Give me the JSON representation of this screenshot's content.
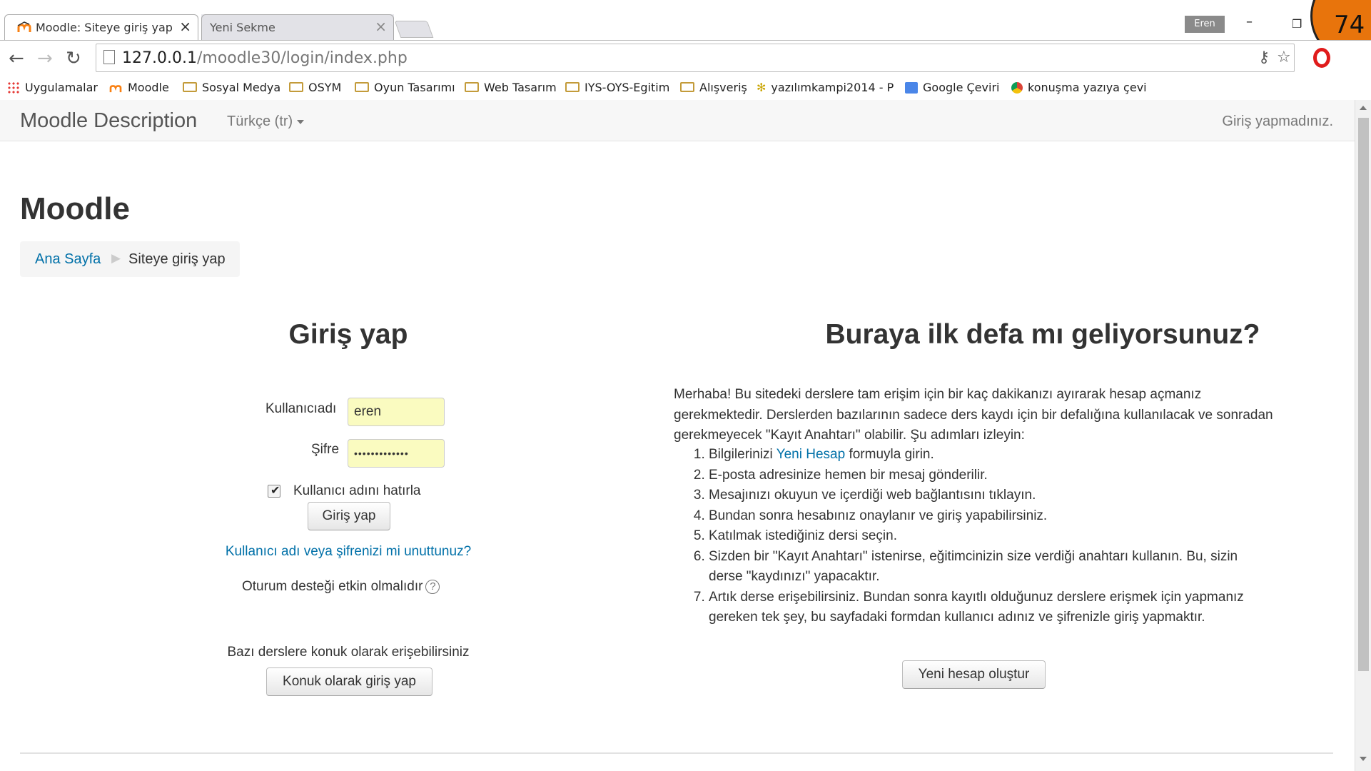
{
  "browser": {
    "active_tab": {
      "title": "Moodle: Siteye giriş yap",
      "close": "×"
    },
    "inactive_tab": {
      "title": "Yeni Sekme",
      "close": "×"
    },
    "profile_name": "Eren",
    "window_min": "–",
    "window_restore": "❐",
    "overlay_badge": "74",
    "url_host": "127.0.0.1",
    "url_path": "/moodle30/login/index.php",
    "bookmarks": [
      {
        "label": "Uygulamalar",
        "icon": "apps-grid-icon"
      },
      {
        "label": "Moodle",
        "icon": "moodle-icon"
      },
      {
        "label": "Sosyal Medya",
        "icon": "folder-icon"
      },
      {
        "label": "OSYM",
        "icon": "folder-icon"
      },
      {
        "label": "Oyun Tasarımı",
        "icon": "folder-icon"
      },
      {
        "label": "Web Tasarım",
        "icon": "folder-icon"
      },
      {
        "label": "IYS-OYS-Egitim",
        "icon": "folder-icon"
      },
      {
        "label": "Alışveriş",
        "icon": "folder-icon"
      },
      {
        "label": "yazılımkampi2014 - P",
        "icon": "cheetah-icon"
      },
      {
        "label": "Google Çeviri",
        "icon": "translate-icon"
      },
      {
        "label": "konuşma yazıya çevir",
        "icon": "chrome-icon"
      }
    ]
  },
  "navbar": {
    "brand": "Moodle Description",
    "language": "Türkçe (tr)",
    "login_state": "Giriş yapmadınız."
  },
  "page": {
    "heading": "Moodle",
    "breadcrumb": {
      "home": "Ana Sayfa",
      "separator": "▶",
      "current": "Siteye giriş yap"
    }
  },
  "login": {
    "title": "Giriş yap",
    "username_label": "Kullanıcıadı",
    "username_value": "eren",
    "password_label": "Şifre",
    "password_value": "•••••••••••••",
    "remember_label": "Kullanıcı adını hatırla",
    "remember_checked": true,
    "submit": "Giriş yap",
    "forgot": "Kullanıcı adı veya şifrenizi mi unuttunuz?",
    "cookies_notice": "Oturum desteği etkin olmalıdır",
    "help_glyph": "?",
    "guest_text": "Bazı derslere konuk olarak erişebilirsiniz",
    "guest_button": "Konuk olarak giriş yap"
  },
  "signup": {
    "title": "Buraya ilk defa mı geliyorsunuz?",
    "intro": "Merhaba! Bu sitedeki derslere tam erişim için bir kaç dakikanızı ayırarak hesap açmanız gerekmektedir. Derslerden bazılarının sadece ders kaydı için bir defalığına kullanılacak ve sonradan gerekmeyecek \"Kayıt Anahtarı\" olabilir. Şu adımları izleyin:",
    "step1_pre": "Bilgilerinizi ",
    "step1_link": "Yeni Hesap",
    "step1_post": " formuyla girin.",
    "steps": [
      "E-posta adresinize hemen bir mesaj gönderilir.",
      "Mesajınızı okuyun ve içerdiği web bağlantısını tıklayın.",
      "Bundan sonra hesabınız onaylanır ve giriş yapabilirsiniz.",
      "Katılmak istediğiniz dersi seçin.",
      "Sizden bir \"Kayıt Anahtarı\" istenirse, eğitimcinizin size verdiği anahtarı kullanın. Bu, sizin derse \"kaydınızı\" yapacaktır.",
      "Artık derse erişebilirsiniz. Bundan sonra kayıtlı olduğunuz derslere erişmek için yapmanız gereken tek şey, bu sayfadaki formdan kullanıcı adınız ve şifrenizle giriş yapmaktır."
    ],
    "button": "Yeni hesap oluştur"
  }
}
